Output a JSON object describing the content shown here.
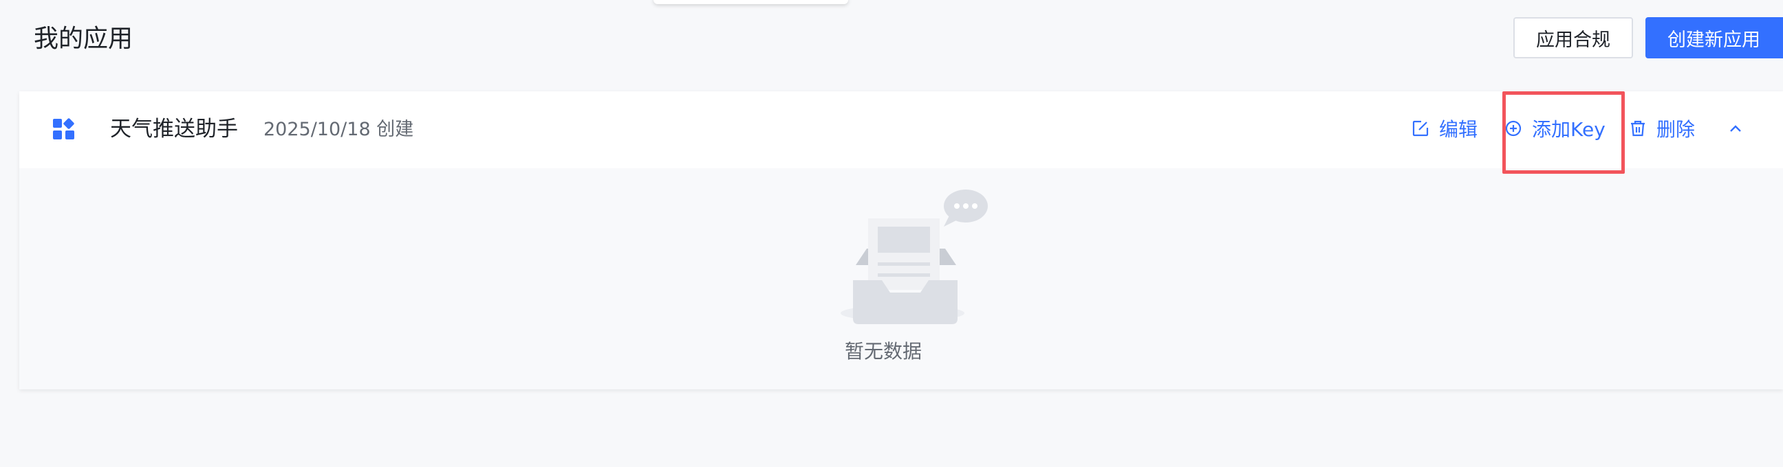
{
  "page": {
    "title": "我的应用"
  },
  "header_buttons": {
    "compliance_label": "应用合规",
    "create_label": "创建新应用"
  },
  "app_card": {
    "name": "天气推送助手",
    "created": "2025/10/18 创建",
    "actions": {
      "edit_label": "编辑",
      "add_key_label": "添加Key",
      "delete_label": "删除"
    },
    "icons": {
      "app": "apps-grid-icon",
      "edit": "edit-icon",
      "add_key": "plus-circle-icon",
      "delete": "trash-icon",
      "collapse": "chevron-up-icon"
    },
    "empty_text": "暂无数据"
  },
  "colors": {
    "accent": "#3370ff",
    "highlight": "#f2545b",
    "background": "#f7f8fa"
  }
}
